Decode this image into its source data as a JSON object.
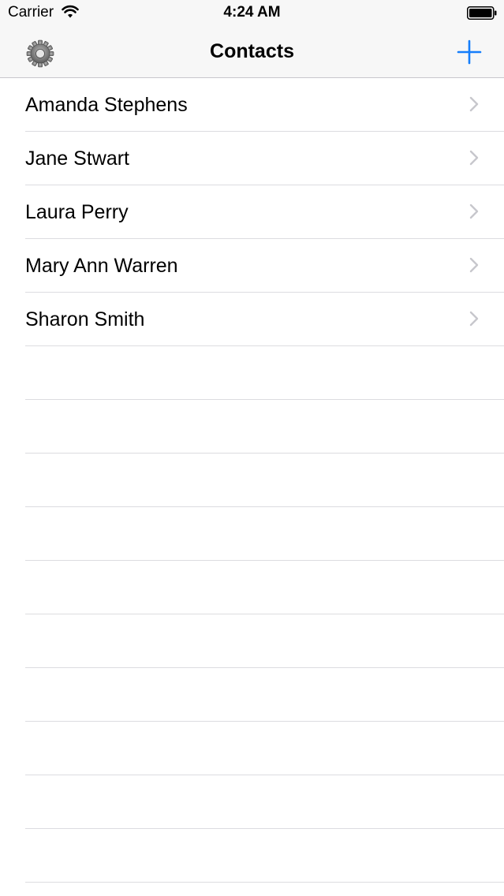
{
  "status_bar": {
    "carrier": "Carrier",
    "time": "4:24 AM",
    "icons": [
      "wifi-icon",
      "battery-icon"
    ]
  },
  "nav_bar": {
    "title": "Contacts",
    "left_icon": "gear-icon",
    "right_icon": "plus-icon",
    "accent_color": "#157efb"
  },
  "contacts": [
    {
      "name": "Amanda Stephens"
    },
    {
      "name": "Jane Stwart"
    },
    {
      "name": "Laura Perry"
    },
    {
      "name": "Mary Ann Warren"
    },
    {
      "name": "Sharon Smith"
    }
  ],
  "colors": {
    "bar_background": "#f7f7f7",
    "separator": "#dcdce0",
    "chevron": "#c7c7cc"
  }
}
